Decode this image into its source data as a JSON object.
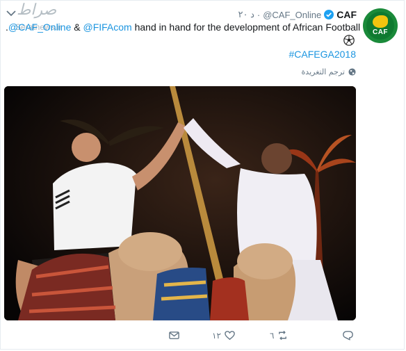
{
  "watermark": {
    "logo_text": "صراط",
    "site": "Seratnews.ir"
  },
  "account": {
    "name": "CAF",
    "handle": "@CAF_Online",
    "separator": "·",
    "time": "۲۰ د",
    "avatar_text": "CAF"
  },
  "tweet": {
    "lead": ".",
    "mention1": "@CAF_Online",
    "amp": " & ",
    "mention2": "@FIFAcom",
    "rest": " hand in hand for the development of African Football",
    "hashtag": "#CAFEGA2018",
    "emoji_icon": "soccer-ball-icon"
  },
  "translate": {
    "label": "ترجم التغريدة",
    "icon": "globe-icon"
  },
  "actions": {
    "reply_icon": "reply-icon",
    "retweet_icon": "retweet-icon",
    "retweet_count": "٦",
    "like_icon": "heart-icon",
    "like_count": "١٢",
    "dm_icon": "mail-icon"
  },
  "colors": {
    "link": "#1b95e0",
    "muted": "#657786",
    "verified": "#1da1f2",
    "caf_green": "#1a8a3a"
  }
}
